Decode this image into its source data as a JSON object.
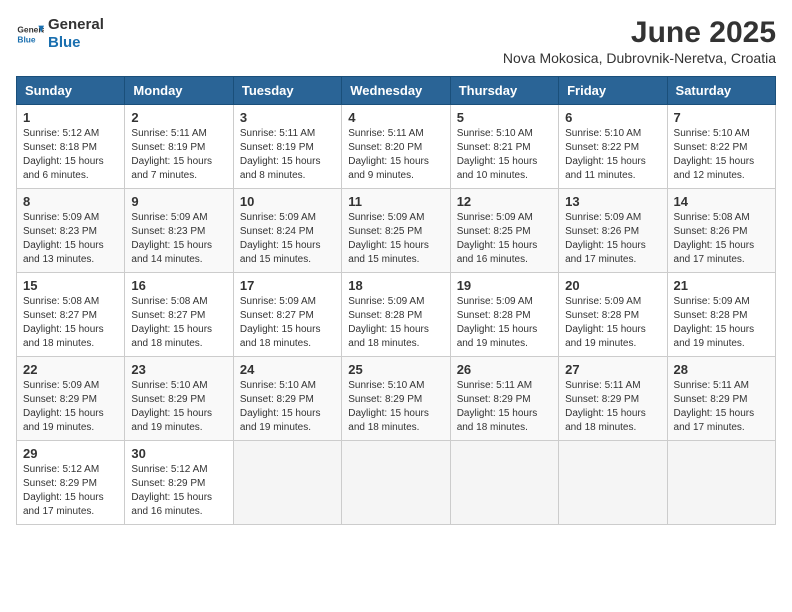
{
  "header": {
    "logo_general": "General",
    "logo_blue": "Blue",
    "month_year": "June 2025",
    "location": "Nova Mokosica, Dubrovnik-Neretva, Croatia"
  },
  "weekdays": [
    "Sunday",
    "Monday",
    "Tuesday",
    "Wednesday",
    "Thursday",
    "Friday",
    "Saturday"
  ],
  "days": [
    {
      "date": 1,
      "sunrise": "5:12 AM",
      "sunset": "8:18 PM",
      "daylight": "15 hours and 6 minutes."
    },
    {
      "date": 2,
      "sunrise": "5:11 AM",
      "sunset": "8:19 PM",
      "daylight": "15 hours and 7 minutes."
    },
    {
      "date": 3,
      "sunrise": "5:11 AM",
      "sunset": "8:19 PM",
      "daylight": "15 hours and 8 minutes."
    },
    {
      "date": 4,
      "sunrise": "5:11 AM",
      "sunset": "8:20 PM",
      "daylight": "15 hours and 9 minutes."
    },
    {
      "date": 5,
      "sunrise": "5:10 AM",
      "sunset": "8:21 PM",
      "daylight": "15 hours and 10 minutes."
    },
    {
      "date": 6,
      "sunrise": "5:10 AM",
      "sunset": "8:22 PM",
      "daylight": "15 hours and 11 minutes."
    },
    {
      "date": 7,
      "sunrise": "5:10 AM",
      "sunset": "8:22 PM",
      "daylight": "15 hours and 12 minutes."
    },
    {
      "date": 8,
      "sunrise": "5:09 AM",
      "sunset": "8:23 PM",
      "daylight": "15 hours and 13 minutes."
    },
    {
      "date": 9,
      "sunrise": "5:09 AM",
      "sunset": "8:23 PM",
      "daylight": "15 hours and 14 minutes."
    },
    {
      "date": 10,
      "sunrise": "5:09 AM",
      "sunset": "8:24 PM",
      "daylight": "15 hours and 15 minutes."
    },
    {
      "date": 11,
      "sunrise": "5:09 AM",
      "sunset": "8:25 PM",
      "daylight": "15 hours and 15 minutes."
    },
    {
      "date": 12,
      "sunrise": "5:09 AM",
      "sunset": "8:25 PM",
      "daylight": "15 hours and 16 minutes."
    },
    {
      "date": 13,
      "sunrise": "5:09 AM",
      "sunset": "8:26 PM",
      "daylight": "15 hours and 17 minutes."
    },
    {
      "date": 14,
      "sunrise": "5:08 AM",
      "sunset": "8:26 PM",
      "daylight": "15 hours and 17 minutes."
    },
    {
      "date": 15,
      "sunrise": "5:08 AM",
      "sunset": "8:27 PM",
      "daylight": "15 hours and 18 minutes."
    },
    {
      "date": 16,
      "sunrise": "5:08 AM",
      "sunset": "8:27 PM",
      "daylight": "15 hours and 18 minutes."
    },
    {
      "date": 17,
      "sunrise": "5:09 AM",
      "sunset": "8:27 PM",
      "daylight": "15 hours and 18 minutes."
    },
    {
      "date": 18,
      "sunrise": "5:09 AM",
      "sunset": "8:28 PM",
      "daylight": "15 hours and 18 minutes."
    },
    {
      "date": 19,
      "sunrise": "5:09 AM",
      "sunset": "8:28 PM",
      "daylight": "15 hours and 19 minutes."
    },
    {
      "date": 20,
      "sunrise": "5:09 AM",
      "sunset": "8:28 PM",
      "daylight": "15 hours and 19 minutes."
    },
    {
      "date": 21,
      "sunrise": "5:09 AM",
      "sunset": "8:28 PM",
      "daylight": "15 hours and 19 minutes."
    },
    {
      "date": 22,
      "sunrise": "5:09 AM",
      "sunset": "8:29 PM",
      "daylight": "15 hours and 19 minutes."
    },
    {
      "date": 23,
      "sunrise": "5:10 AM",
      "sunset": "8:29 PM",
      "daylight": "15 hours and 19 minutes."
    },
    {
      "date": 24,
      "sunrise": "5:10 AM",
      "sunset": "8:29 PM",
      "daylight": "15 hours and 19 minutes."
    },
    {
      "date": 25,
      "sunrise": "5:10 AM",
      "sunset": "8:29 PM",
      "daylight": "15 hours and 18 minutes."
    },
    {
      "date": 26,
      "sunrise": "5:11 AM",
      "sunset": "8:29 PM",
      "daylight": "15 hours and 18 minutes."
    },
    {
      "date": 27,
      "sunrise": "5:11 AM",
      "sunset": "8:29 PM",
      "daylight": "15 hours and 18 minutes."
    },
    {
      "date": 28,
      "sunrise": "5:11 AM",
      "sunset": "8:29 PM",
      "daylight": "15 hours and 17 minutes."
    },
    {
      "date": 29,
      "sunrise": "5:12 AM",
      "sunset": "8:29 PM",
      "daylight": "15 hours and 17 minutes."
    },
    {
      "date": 30,
      "sunrise": "5:12 AM",
      "sunset": "8:29 PM",
      "daylight": "15 hours and 16 minutes."
    }
  ],
  "labels": {
    "sunrise": "Sunrise:",
    "sunset": "Sunset:",
    "daylight": "Daylight:"
  }
}
